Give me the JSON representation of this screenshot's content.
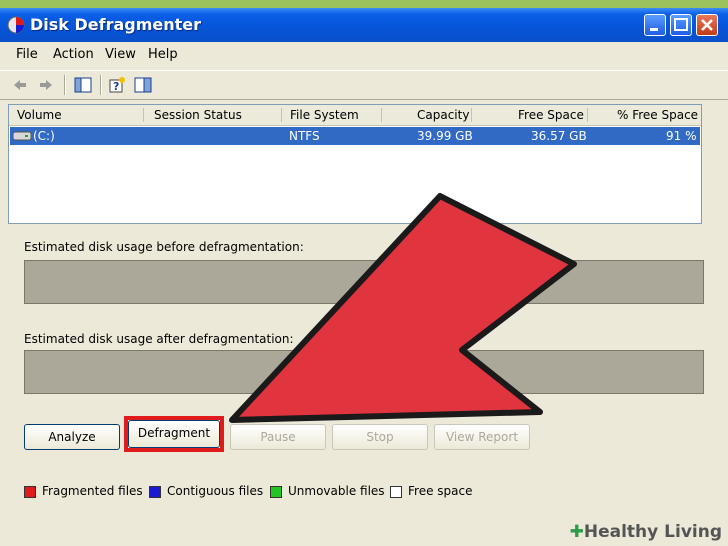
{
  "window": {
    "title": "Disk Defragmenter"
  },
  "menu": [
    "File",
    "Action",
    "View",
    "Help"
  ],
  "columns": [
    "Volume",
    "Session Status",
    "File System",
    "Capacity",
    "Free Space",
    "% Free Space"
  ],
  "volume_row": {
    "volume": "(C:)",
    "session_status": "",
    "file_system": "NTFS",
    "capacity": "39.99 GB",
    "free_space": "36.57 GB",
    "pct_free": "91 %"
  },
  "labels": {
    "before": "Estimated disk usage before defragmentation:",
    "after": "Estimated disk usage after defragmentation:"
  },
  "buttons": {
    "analyze": "Analyze",
    "defragment": "Defragment",
    "pause": "Pause",
    "stop": "Stop",
    "view_report": "View Report"
  },
  "legend": [
    {
      "label": "Fragmented files",
      "color": "#e01b1b"
    },
    {
      "label": "Contiguous files",
      "color": "#1a1ad6"
    },
    {
      "label": "Unmovable files",
      "color": "#22c522"
    },
    {
      "label": "Free space",
      "color": "#ffffff"
    }
  ],
  "colors": {
    "selection": "#316ac5",
    "highlight_box": "#e01b1b",
    "annotation_arrow": "#e0343e"
  },
  "watermark": "Healthy Living"
}
